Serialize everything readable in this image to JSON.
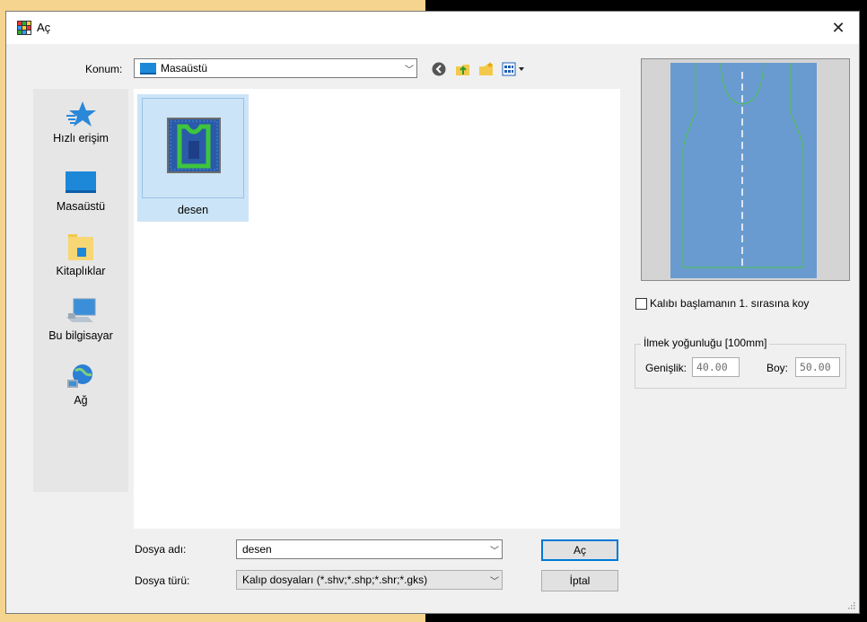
{
  "window": {
    "title": "Aç",
    "close_label": "✕"
  },
  "location": {
    "label": "Konum:",
    "value": "Masaüstü"
  },
  "toolbar": {
    "icons": [
      "back-icon",
      "up-folder-icon",
      "new-folder-icon",
      "view-menu-icon"
    ]
  },
  "places": [
    {
      "label": "Hızlı erişim",
      "icon": "quick-access-star-icon"
    },
    {
      "label": "Masaüstü",
      "icon": "desktop-icon"
    },
    {
      "label": "Kitaplıklar",
      "icon": "libraries-icon"
    },
    {
      "label": "Bu bilgisayar",
      "icon": "computer-icon"
    },
    {
      "label": "Ağ",
      "icon": "network-icon"
    }
  ],
  "files": [
    {
      "name": "desen",
      "selected": true
    }
  ],
  "form": {
    "filename_label": "Dosya adı:",
    "filename_value": "desen",
    "filetype_label": "Dosya türü:",
    "filetype_value": "Kalıp dosyaları (*.shv;*.shp;*.shr;*.gks)",
    "open_button": "Aç",
    "cancel_button": "İptal"
  },
  "options": {
    "checkbox_label": "Kalıbı başlamanın 1. sırasına koy",
    "checkbox_checked": false,
    "density_group_title": "İlmek yoğunluğu [100mm]",
    "width_label": "Genişlik:",
    "width_value": "40.00",
    "height_label": "Boy:",
    "height_value": "50.00"
  },
  "colors": {
    "selection": "#cce4f7",
    "preview_fabric": "#6699cc",
    "pattern_line": "#33cc33",
    "accent": "#0078d7"
  }
}
